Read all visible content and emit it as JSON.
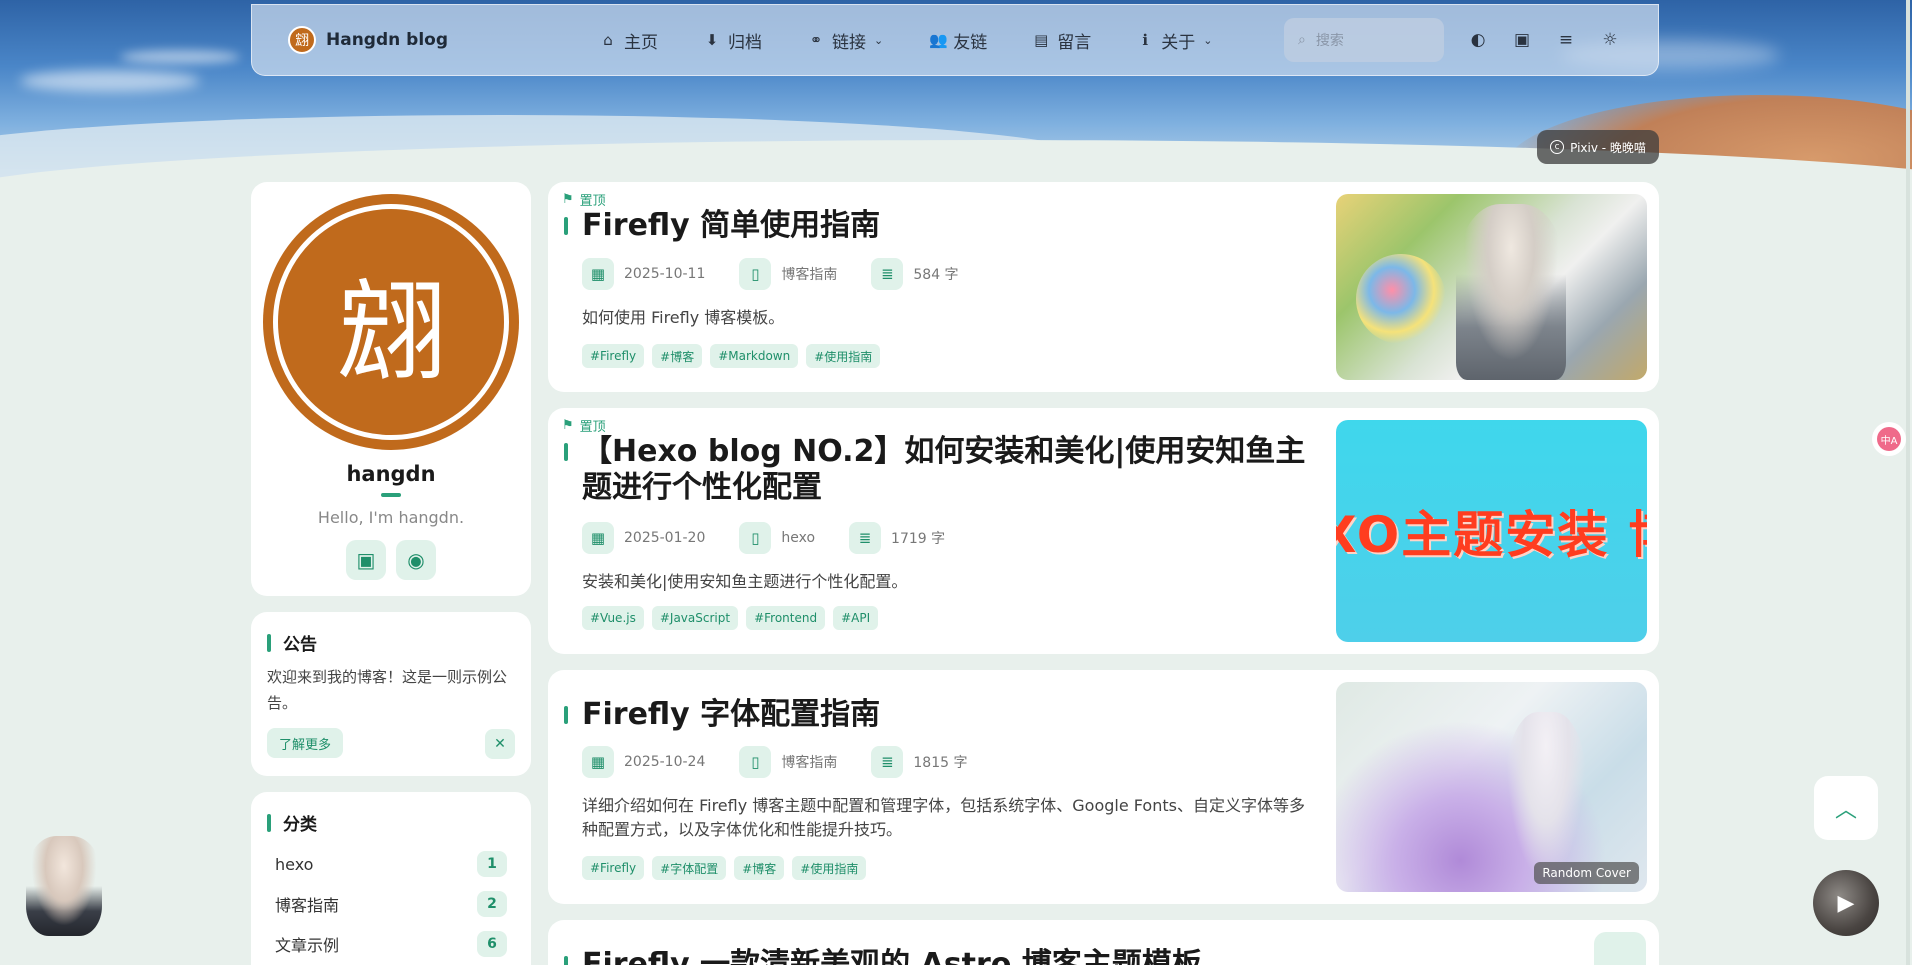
{
  "header": {
    "brand": "Hangdn blog",
    "logo_char": "翝",
    "nav": [
      {
        "icon": "home-icon",
        "glyph": "⌂",
        "label": "主页",
        "dropdown": false
      },
      {
        "icon": "archive-icon",
        "glyph": "⬇",
        "label": "归档",
        "dropdown": false
      },
      {
        "icon": "link-icon",
        "glyph": "⚭",
        "label": "链接",
        "dropdown": true
      },
      {
        "icon": "friends-icon",
        "glyph": "👥",
        "label": "友链",
        "dropdown": false
      },
      {
        "icon": "comment-icon",
        "glyph": "▤",
        "label": "留言",
        "dropdown": false
      },
      {
        "icon": "info-icon",
        "glyph": "ℹ",
        "label": "关于",
        "dropdown": true
      }
    ],
    "search_placeholder": "搜索",
    "tools": [
      {
        "icon": "palette-icon",
        "glyph": "◐"
      },
      {
        "icon": "image-icon",
        "glyph": "▣"
      },
      {
        "icon": "menu-icon",
        "glyph": "≡"
      },
      {
        "icon": "sun-icon",
        "glyph": "☼"
      }
    ]
  },
  "banner_credit": "Pixiv - 晚晚喵",
  "profile": {
    "avatar_char": "翝",
    "name": "hangdn",
    "bio": "Hello, I'm hangdn.",
    "socials": [
      {
        "icon": "bilibili-icon",
        "glyph": "▣"
      },
      {
        "icon": "github-icon",
        "glyph": "◉"
      }
    ]
  },
  "notice": {
    "title": "公告",
    "text": "欢迎来到我的博客！这是一则示例公告。",
    "button": "了解更多",
    "close": "✕"
  },
  "categories": {
    "title": "分类",
    "items": [
      {
        "name": "hexo",
        "count": "1"
      },
      {
        "name": "博客指南",
        "count": "2"
      },
      {
        "name": "文章示例",
        "count": "6"
      }
    ]
  },
  "posts": [
    {
      "pinned_label": "置顶",
      "title": "Firefly 简单使用指南",
      "date": "2025-10-11",
      "category": "博客指南",
      "words": "584 字",
      "description": "如何使用 Firefly 博客模板。",
      "tags": [
        "#Firefly",
        "#博客",
        "#Markdown",
        "#使用指南"
      ]
    },
    {
      "pinned_label": "置顶",
      "title": "【Hexo blog NO.2】如何安装和美化|使用安知鱼主题进行个性化配置",
      "date": "2025-01-20",
      "category": "hexo",
      "words": "1719 字",
      "description": "安装和美化|使用安知鱼主题进行个性化配置。",
      "tags": [
        "#Vue.js",
        "#JavaScript",
        "#Frontend",
        "#API"
      ],
      "cover_text": "XO主题安装 博客美化"
    },
    {
      "title": "Firefly 字体配置指南",
      "date": "2025-10-24",
      "category": "博客指南",
      "words": "1815 字",
      "description": "详细介绍如何在 Firefly 博客主题中配置和管理字体，包括系统字体、Google Fonts、自定义字体等多种配置方式，以及字体优化和性能提升技巧。",
      "tags": [
        "#Firefly",
        "#字体配置",
        "#博客",
        "#使用指南"
      ],
      "cover_label": "Random Cover"
    },
    {
      "title": "Firefly 一款清新美观的 Astro 博客主题模板"
    }
  ],
  "widgets": {
    "scroll_top": "︿",
    "music": "▶",
    "translate": "中A"
  },
  "colors": {
    "accent": "#2aa07a",
    "accent_bg": "#e0f2ea",
    "page_bg": "#e8f0ec",
    "avatar": "#c06a1c"
  }
}
